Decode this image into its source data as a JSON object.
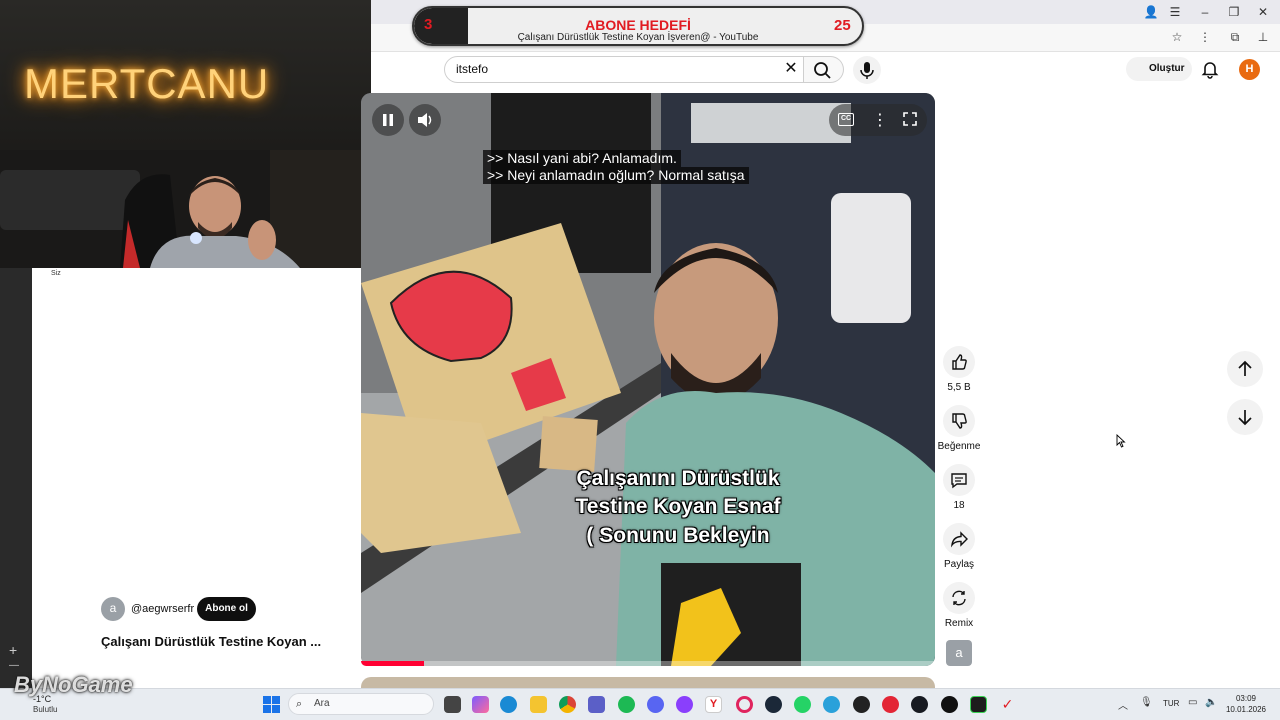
{
  "browser": {
    "tab_title": "Çalışanı Dürüstlük Testine Koyan İşveren@ - YouTube"
  },
  "youtube": {
    "search": {
      "value": "itstefo"
    },
    "create_label": "Oluştur",
    "avatar_letter": "H",
    "you_label": "Siz"
  },
  "stream_overlay": {
    "neon_sign": "MERTCANU",
    "goal": {
      "title": "ABONE HEDEFİ",
      "current": "3",
      "target": "25",
      "progress_fraction": 0.12,
      "subtitle": "Çalışanı Dürüstlük Testine Koyan İşveren@ - YouTube"
    },
    "watermark": "ByNoGame"
  },
  "video": {
    "captions": [
      ">> Nasıl yani abi? Anlamadım.",
      ">> Neyi anlamadın oğlum? Normal satışa"
    ],
    "overlay_title": [
      "Çalışanını Dürüstlük",
      "Testine Koyan Esnaf",
      "( Sonunu Bekleyin"
    ],
    "progress_fraction": 0.11,
    "cc_label": "CC"
  },
  "actions": {
    "like_count": "5,5 B",
    "dislike_label": "Beğenme",
    "comment_count": "18",
    "share_label": "Paylaş",
    "remix_label": "Remix",
    "channel_thumb_letter": "a"
  },
  "channel": {
    "avatar_letter": "a",
    "handle": "@aegwrserfr",
    "subscribe_label": "Abone ol",
    "video_title": "Çalışanı Dürüstlük Testine Koyan ..."
  },
  "taskbar": {
    "weather_temp": "-1°C",
    "weather_desc": "Bulutlu",
    "search_placeholder": "Ara",
    "language": "TUR",
    "time": "03:09",
    "date": "10.01.2026"
  },
  "colors": {
    "accent_red": "#ff0033",
    "goal_red": "#e11b22",
    "neon": "#ffb13b",
    "avatar_orange": "#e96a10"
  }
}
